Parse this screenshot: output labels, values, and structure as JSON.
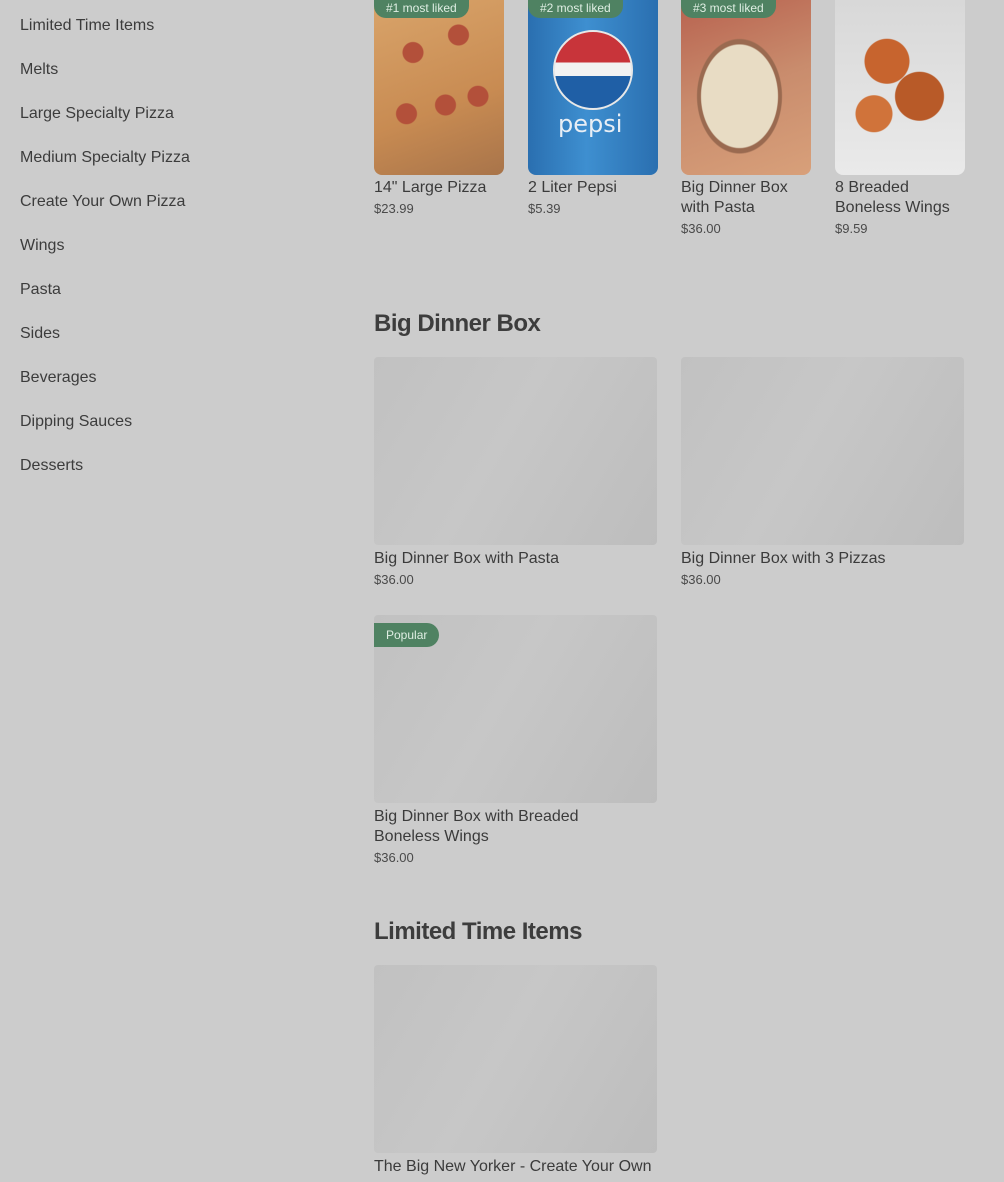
{
  "sidebar": {
    "items": [
      {
        "label": "Limited Time Items"
      },
      {
        "label": "Melts"
      },
      {
        "label": "Large Specialty Pizza"
      },
      {
        "label": "Medium Specialty Pizza"
      },
      {
        "label": "Create Your Own Pizza"
      },
      {
        "label": "Wings"
      },
      {
        "label": "Pasta"
      },
      {
        "label": "Sides"
      },
      {
        "label": "Beverages"
      },
      {
        "label": "Dipping Sauces"
      },
      {
        "label": "Desserts"
      }
    ]
  },
  "most_liked": [
    {
      "badge": "#1 most liked",
      "name": "14\" Large Pizza",
      "price": "$23.99",
      "image": "pizza"
    },
    {
      "badge": "#2 most liked",
      "name": "2 Liter Pepsi",
      "price": "$5.39",
      "image": "pepsi",
      "logo_text": "pepsi"
    },
    {
      "badge": "#3 most liked",
      "name": "Big Dinner Box with Pasta",
      "price": "$36.00",
      "image": "dinner-box"
    },
    {
      "badge": "",
      "name": "8 Breaded Boneless Wings",
      "price": "$9.59",
      "image": "wings"
    }
  ],
  "big_dinner_box": {
    "title": "Big Dinner Box",
    "items": [
      {
        "name": "Big Dinner Box with Pasta",
        "price": "$36.00",
        "badge": ""
      },
      {
        "name": "Big Dinner Box with 3 Pizzas",
        "price": "$36.00",
        "badge": ""
      },
      {
        "name": "Big Dinner Box with Breaded Boneless Wings",
        "price": "$36.00",
        "badge": "Popular"
      }
    ]
  },
  "limited_time": {
    "title": "Limited Time Items",
    "items": [
      {
        "name": "The Big New Yorker - Create Your Own",
        "price": ""
      }
    ]
  },
  "colors": {
    "badge_bg": "#4f8262",
    "overlay_bg": "#cccccc"
  }
}
